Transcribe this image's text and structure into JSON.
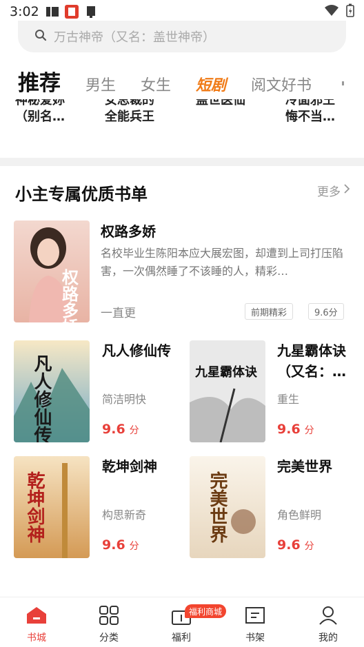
{
  "status_bar": {
    "time": "3:02"
  },
  "search": {
    "placeholder": "万古神帝（又名：盖世神帝）"
  },
  "tabs": [
    {
      "label": "推荐"
    },
    {
      "label": "男生"
    },
    {
      "label": "女生"
    },
    {
      "label": "短剧"
    },
    {
      "label": "阅文好书"
    }
  ],
  "partial_row": [
    {
      "line1": "神秘爱妳",
      "line2": "（别名…"
    },
    {
      "line1": "女总裁的",
      "line2": "全能兵王"
    },
    {
      "line1": "盖世医仙",
      "line2": ""
    },
    {
      "line1": "冷面邪王",
      "line2": "悔不当…"
    }
  ],
  "section": {
    "title": "小主专属优质书单",
    "more": "更多"
  },
  "featured": {
    "title": "权路多娇",
    "desc": "名校毕业生陈阳本应大展宏图，却遭到上司打压陷害，一次偶然睡了不该睡的人，精彩…",
    "author": "一直更",
    "tags": [
      "前期精彩",
      "9.6分"
    ],
    "cover_text": "权路多娇"
  },
  "books": [
    {
      "title": "凡人修仙传",
      "sub": "简洁明快",
      "score": "9.6",
      "unit": "分",
      "cover_text": "凡人修仙传"
    },
    {
      "title": "九星霸体诀（又名：…",
      "sub": "重生",
      "score": "9.6",
      "unit": "分",
      "cover_text": "九星霸体诀"
    },
    {
      "title": "乾坤剑神",
      "sub": "构思新奇",
      "score": "9.6",
      "unit": "分",
      "cover_text": "乾坤剑神"
    },
    {
      "title": "完美世界",
      "sub": "角色鲜明",
      "score": "9.6",
      "unit": "分",
      "cover_text": "完美世界"
    }
  ],
  "bottom_nav": [
    {
      "label": "书城"
    },
    {
      "label": "分类"
    },
    {
      "label": "福利"
    },
    {
      "label": "书架"
    },
    {
      "label": "我的"
    }
  ],
  "welfare_badge": "福利商城",
  "colors": {
    "accent": "#e8403a",
    "special_tab": "#f07a16"
  }
}
